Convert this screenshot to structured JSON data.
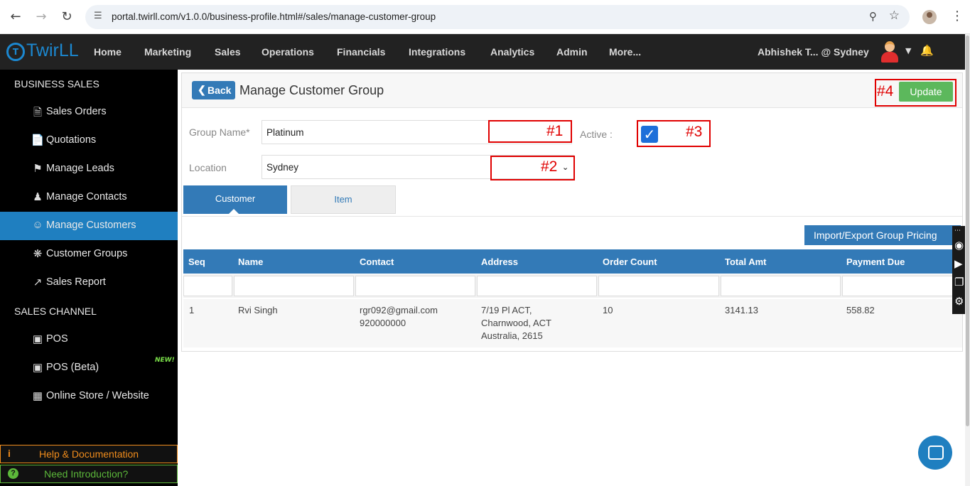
{
  "browser": {
    "url": "portal.twirll.com/v1.0.0/business-profile.html#/sales/manage-customer-group"
  },
  "topnav": {
    "logo_text": "TwirLL",
    "menu": [
      "Home",
      "Marketing",
      "Sales",
      "Operations",
      "Financials",
      "Integrations",
      "Analytics",
      "Admin",
      "More..."
    ],
    "user": "Abhishek T...  @ Sydney"
  },
  "sidebar": {
    "section1": "BUSINESS SALES",
    "items1": [
      {
        "label": "Sales Orders",
        "icon": "document-icon"
      },
      {
        "label": "Quotations",
        "icon": "file-icon"
      },
      {
        "label": "Manage Leads",
        "icon": "tags-icon"
      },
      {
        "label": "Manage Contacts",
        "icon": "users-icon"
      },
      {
        "label": "Manage Customers",
        "icon": "user-circle-icon"
      },
      {
        "label": "Customer Groups",
        "icon": "cluster-icon"
      },
      {
        "label": "Sales Report",
        "icon": "chart-line-icon"
      }
    ],
    "section2": "SALES CHANNEL",
    "items2": [
      {
        "label": "POS",
        "icon": "monitor-icon"
      },
      {
        "label": "POS (Beta)",
        "icon": "monitor-icon"
      },
      {
        "label": "Online Store / Website",
        "icon": "store-icon"
      }
    ],
    "new_badge": "NEW!",
    "help": "Help & Documentation",
    "intro": "Need Introduction?"
  },
  "page": {
    "back_label": "Back",
    "title": "Manage Customer Group",
    "update_label": "Update",
    "group_name_label": "Group Name*",
    "group_name_value": "Platinum",
    "location_label": "Location",
    "location_value": "Sydney",
    "active_label": "Active :",
    "active_checked": true,
    "tabs": [
      "Customer",
      "Item"
    ],
    "import_export_label": "Import/Export Group Pricing",
    "annotations": [
      "#1",
      "#2",
      "#3",
      "#4"
    ]
  },
  "table": {
    "headers": [
      "Seq",
      "Name",
      "Contact",
      "Address",
      "Order Count",
      "Total Amt",
      "Payment Due"
    ],
    "rows": [
      {
        "seq": "1",
        "name": "Rvi Singh",
        "contact_email": "rgr092@gmail.com",
        "contact_phone": "920000000",
        "address_line1": "7/19 Pl ACT,",
        "address_line2": "Charnwood, ACT",
        "address_line3": "Australia, 2615",
        "order_count": "10",
        "total_amt": "3141.13",
        "payment_due": "558.82"
      }
    ]
  },
  "colors": {
    "primary": "#337ab7",
    "success": "#5cb85c",
    "annotation": "#e00000",
    "sidebar_active": "#1f7fc0"
  }
}
